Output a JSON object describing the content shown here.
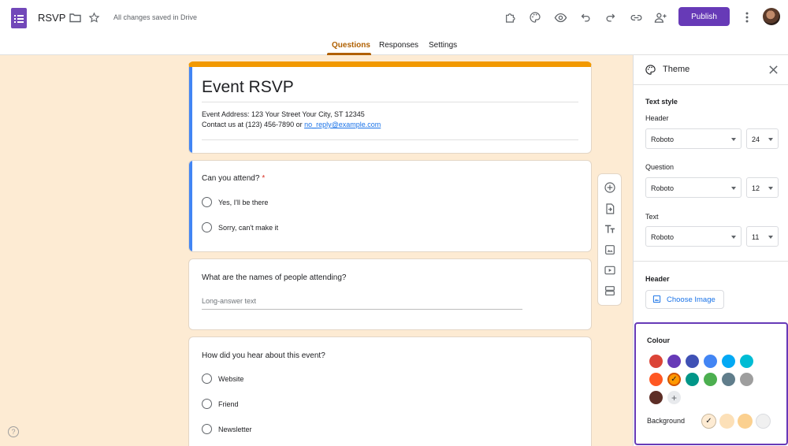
{
  "header": {
    "doc_title": "RSVP",
    "save_status": "All changes saved in Drive",
    "publish_label": "Publish"
  },
  "tabs": [
    {
      "label": "Questions",
      "active": true
    },
    {
      "label": "Responses",
      "active": false
    },
    {
      "label": "Settings",
      "active": false
    }
  ],
  "form": {
    "title": "Event RSVP",
    "description_line1": "Event Address: 123 Your Street Your City, ST 12345",
    "description_line2_prefix": "Contact us at (123) 456-7890 or ",
    "description_email": "no_reply@example.com"
  },
  "questions": [
    {
      "text": "Can you attend?",
      "required_mark": "*",
      "options": [
        "Yes,  I'll be there",
        "Sorry, can't make it"
      ]
    },
    {
      "text": "What are the names of people attending?",
      "placeholder": "Long-answer text"
    },
    {
      "text": "How did you hear about this event?",
      "options": [
        "Website",
        "Friend",
        "Newsletter"
      ]
    }
  ],
  "theme_panel": {
    "title": "Theme",
    "text_style_label": "Text style",
    "header_label": "Header",
    "header_font": "Roboto",
    "header_size": "24",
    "question_label": "Question",
    "question_font": "Roboto",
    "question_size": "12",
    "text_label": "Text",
    "text_font": "Roboto",
    "text_size": "11",
    "header_section_label": "Header",
    "choose_image_label": "Choose Image",
    "colour_label": "Colour",
    "background_label": "Background",
    "selected_mark": "✓",
    "add_mark": "+",
    "colours": [
      "#db4437",
      "#673ab7",
      "#3f51b5",
      "#4285f4",
      "#03a9f4",
      "#00bcd4",
      "#ff5722",
      "#ff9800",
      "#009688",
      "#4caf50",
      "#607d8b",
      "#9e9e9e",
      "#5d2e26"
    ],
    "selected_colour": "#ff9800",
    "backgrounds": [
      "#fdebd3",
      "#fce0b8",
      "#fbd08f",
      "#f0f0f0"
    ],
    "selected_background": "#fdebd3"
  },
  "help_icon_label": "?"
}
